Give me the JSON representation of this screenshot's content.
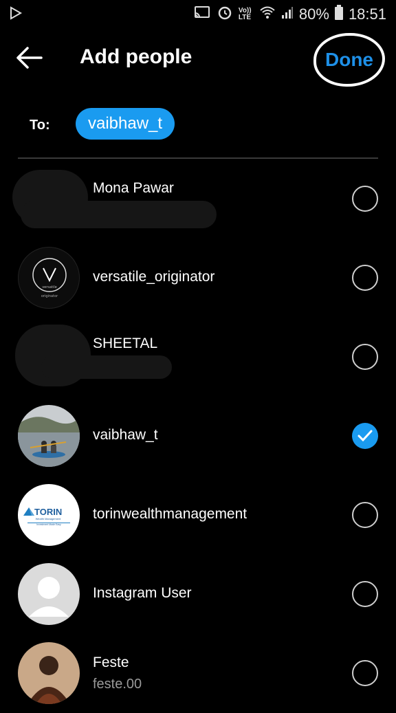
{
  "status_bar": {
    "volte": "Vo)) LTE",
    "battery": "80%",
    "time": "18:51",
    "icons": [
      "play-store-icon",
      "cast-icon",
      "alarm-icon",
      "wifi-icon",
      "signal-icon",
      "battery-icon"
    ]
  },
  "header": {
    "title": "Add people",
    "done_label": "Done",
    "back_icon": "arrow-left-icon"
  },
  "to": {
    "label": "To:",
    "selected_chip": "vaibhaw_t"
  },
  "accent_color": "#1a9bf0",
  "users": [
    {
      "name": "Mona Pawar",
      "subtitle": "",
      "checked": false,
      "avatar": "redacted"
    },
    {
      "name": "versatile_originator",
      "subtitle": "",
      "checked": false,
      "avatar": "logo-versatile"
    },
    {
      "name": "SHEETAL",
      "subtitle": "",
      "checked": false,
      "avatar": "redacted"
    },
    {
      "name": "vaibhaw_t",
      "subtitle": "",
      "checked": true,
      "avatar": "photo-kayak"
    },
    {
      "name": "torinwealthmanagement",
      "subtitle": "",
      "checked": false,
      "avatar": "logo-torin"
    },
    {
      "name": "Instagram User",
      "subtitle": "",
      "checked": false,
      "avatar": "default-profile"
    },
    {
      "name": "Feste",
      "subtitle": "feste.00",
      "checked": false,
      "avatar": "photo-portrait"
    }
  ],
  "logos": {
    "versatile": {
      "letter": "V",
      "text": "versatile",
      "tag": "originator"
    },
    "torin": {
      "name": "TORIN",
      "subtitle": "Wealth Management",
      "tagline": "Investment Made Easy"
    }
  }
}
